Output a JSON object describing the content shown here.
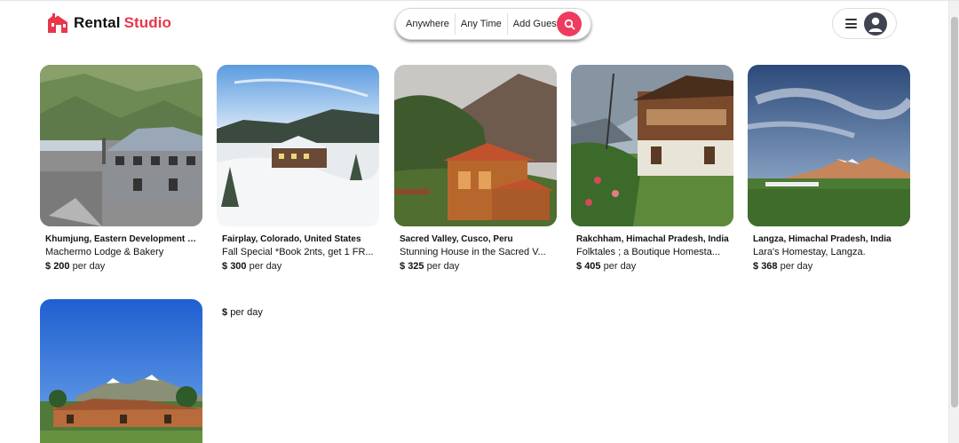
{
  "brand": {
    "word1": "Rental",
    "word2": "Studio",
    "accent": "#e8374a"
  },
  "search": {
    "where": "Anywhere",
    "when": "Any Time",
    "who": "Add Guests",
    "button_color": "#ef3b5e"
  },
  "listings": [
    {
      "location": "Khumjung, Eastern Development R...",
      "title": "Machermo Lodge & Bakery",
      "currency": "$",
      "price": "200",
      "unit": "per day"
    },
    {
      "location": "Fairplay, Colorado, United States",
      "title": "Fall Special *Book 2nts, get 1 FR...",
      "currency": "$",
      "price": "300",
      "unit": "per day"
    },
    {
      "location": "Sacred Valley, Cusco, Peru",
      "title": "Stunning House in the Sacred V...",
      "currency": "$",
      "price": "325",
      "unit": "per day"
    },
    {
      "location": "Rakchham, Himachal Pradesh, India",
      "title": "Folktales ; a Boutique Homesta...",
      "currency": "$",
      "price": "405",
      "unit": "per day"
    },
    {
      "location": "Langza, Himachal Pradesh, India",
      "title": "Lara's Homestay, Langza.",
      "currency": "$",
      "price": "368",
      "unit": "per day"
    }
  ],
  "partial_listing": {
    "currency": "$",
    "unit": "per day"
  }
}
